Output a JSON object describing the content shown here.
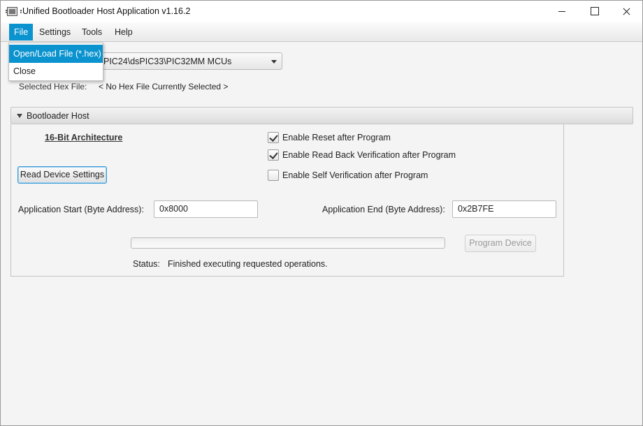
{
  "window": {
    "title": "Unified Bootloader Host Application v1.16.2",
    "app_icon": "chip-icon"
  },
  "menubar": {
    "items": [
      {
        "label": "File",
        "active": true
      },
      {
        "label": "Settings"
      },
      {
        "label": "Tools"
      },
      {
        "label": "Help"
      }
    ]
  },
  "file_menu": {
    "items": [
      {
        "label": "Open/Load File (*.hex)",
        "highlighted": true
      },
      {
        "label": "Close"
      }
    ]
  },
  "device_select": {
    "value": "PIC24\\dsPIC33\\PIC32MM MCUs"
  },
  "hex_file": {
    "label": "Selected Hex File:",
    "value": "< No Hex File Currently Selected >"
  },
  "bootloader": {
    "section_title": "Bootloader Host",
    "architecture": "16-Bit Architecture",
    "read_button": "Read Device Settings",
    "options": [
      {
        "label": "Enable Reset after Program",
        "checked": true
      },
      {
        "label": "Enable Read Back Verification after Program",
        "checked": true
      },
      {
        "label": "Enable Self Verification after Program",
        "checked": false
      }
    ],
    "app_start_label": "Application Start (Byte Address):",
    "app_start_value": "0x8000",
    "app_end_label": "Application End (Byte Address):",
    "app_end_value": "0x2B7FE",
    "progress": 0,
    "program_button": "Program Device",
    "status_label": "Status:",
    "status_value": "Finished executing requested operations."
  },
  "colors": {
    "accent": "#0b93cf",
    "background": "#f4f4f4"
  }
}
